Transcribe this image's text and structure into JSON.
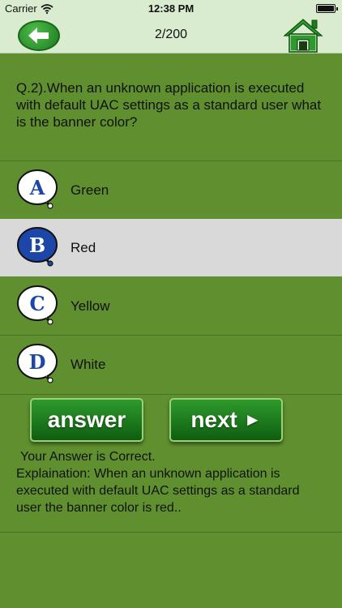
{
  "status_bar": {
    "carrier": "Carrier",
    "time": "12:38 PM",
    "battery_level": 1.0
  },
  "nav": {
    "progress": "2/200",
    "back_icon": "back-arrow-icon",
    "home_icon": "home-icon"
  },
  "question": {
    "text": "Q.2).When an unknown application is executed with default UAC settings as a standard user what is the banner color?"
  },
  "options": [
    {
      "letter": "A",
      "label": "Green",
      "selected": false
    },
    {
      "letter": "B",
      "label": "Red",
      "selected": true
    },
    {
      "letter": "C",
      "label": "Yellow",
      "selected": false
    },
    {
      "letter": "D",
      "label": "White",
      "selected": false
    }
  ],
  "buttons": {
    "answer_label": "answer",
    "next_label": "next",
    "next_arrow": "►"
  },
  "result": {
    "status": "Your Answer is Correct.",
    "explanation": "Explaination: When an unknown application is executed with default UAC settings as a standard user the banner color is red.."
  },
  "colors": {
    "background": "#5f8f2e",
    "bar": "#d9ecd0",
    "selected_row": "#d9d9d9",
    "button_green": "#1f7a1f",
    "letter_blue": "#1c47a8"
  }
}
